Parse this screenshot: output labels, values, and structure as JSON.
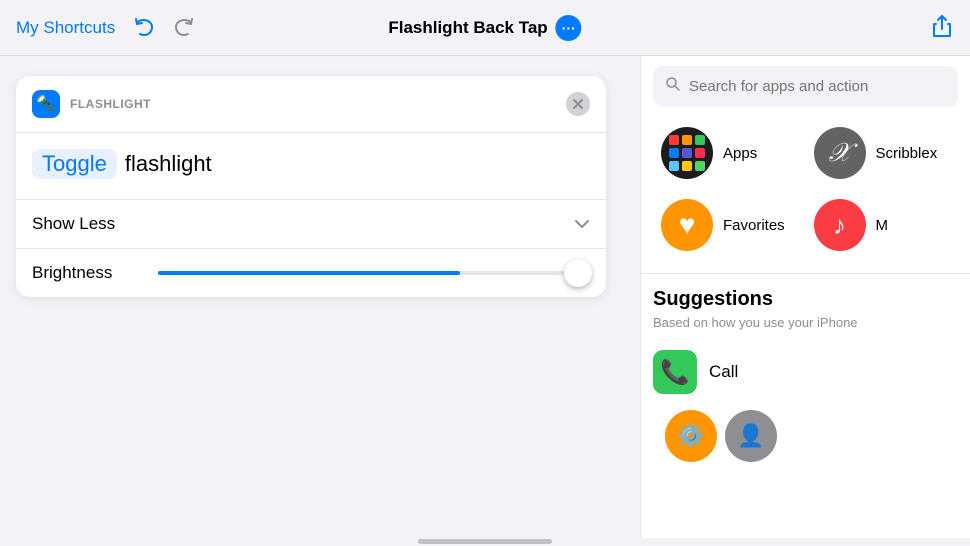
{
  "header": {
    "my_shortcuts_label": "My Shortcuts",
    "title": "Flashlight Back Tap",
    "more_icon": "•••",
    "share_icon": "↑"
  },
  "action_card": {
    "icon_label": "FLASHLIGHT",
    "toggle_label": "Toggle",
    "flashlight_label": "flashlight",
    "show_less_label": "Show Less",
    "brightness_label": "Brightness",
    "slider_fill_percent": 70
  },
  "right_panel": {
    "search_placeholder": "Search for apps and action",
    "categories": [
      {
        "label": "Apps",
        "icon_type": "apps"
      },
      {
        "label": "Scribblex",
        "icon_type": "scribblex",
        "letter": "𝒳"
      },
      {
        "label": "Favorites",
        "icon_type": "favorites"
      },
      {
        "label": "Music",
        "icon_type": "music",
        "partial_label": "M"
      }
    ],
    "suggestions_title": "Suggestions",
    "suggestions_subtitle": "Based on how you use your iPhone",
    "suggestions": [
      {
        "label": "Call",
        "icon_type": "call"
      }
    ]
  }
}
